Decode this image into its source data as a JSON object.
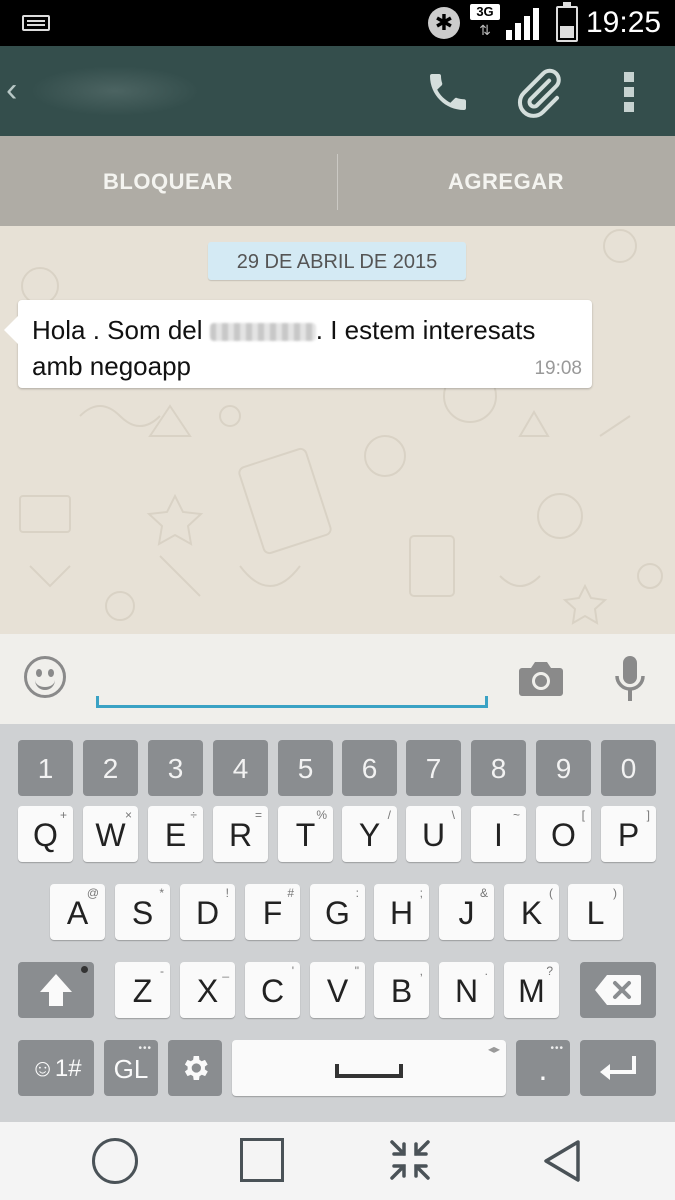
{
  "status_bar": {
    "network_type": "3G",
    "network_arrows": "⇅",
    "bluetooth_glyph": "✱",
    "time": "19:25"
  },
  "app_bar": {
    "back_glyph": "‹",
    "icons": [
      "back-icon",
      "phone-icon",
      "paperclip-icon",
      "overflow-menu-icon"
    ]
  },
  "actions": {
    "block_label": "BLOQUEAR",
    "add_label": "AGREGAR"
  },
  "chat": {
    "date_chip": "29 DE ABRIL DE 2015",
    "message": {
      "text_before": "Hola . Som del",
      "text_after": ". I estem interesats amb negoapp",
      "time": "19:08"
    },
    "background_color": "#e7e1d6"
  },
  "composer": {
    "value": "",
    "accent_color": "#3aa2c4",
    "icons": [
      "emoji-icon",
      "camera-icon",
      "microphone-icon"
    ]
  },
  "keyboard": {
    "number_row": [
      "1",
      "2",
      "3",
      "4",
      "5",
      "6",
      "7",
      "8",
      "9",
      "0"
    ],
    "row1": [
      {
        "k": "Q",
        "s": "+"
      },
      {
        "k": "W",
        "s": "×"
      },
      {
        "k": "E",
        "s": "÷"
      },
      {
        "k": "R",
        "s": "="
      },
      {
        "k": "T",
        "s": "%"
      },
      {
        "k": "Y",
        "s": "/"
      },
      {
        "k": "U",
        "s": "\\"
      },
      {
        "k": "I",
        "s": "~"
      },
      {
        "k": "O",
        "s": "["
      },
      {
        "k": "P",
        "s": "]"
      }
    ],
    "row2": [
      {
        "k": "A",
        "s": "@"
      },
      {
        "k": "S",
        "s": "*"
      },
      {
        "k": "D",
        "s": "!"
      },
      {
        "k": "F",
        "s": "#"
      },
      {
        "k": "G",
        "s": ":"
      },
      {
        "k": "H",
        "s": ";"
      },
      {
        "k": "J",
        "s": "&"
      },
      {
        "k": "K",
        "s": "("
      },
      {
        "k": "L",
        "s": ")"
      }
    ],
    "row3": [
      {
        "k": "Z",
        "s": "-"
      },
      {
        "k": "X",
        "s": "_"
      },
      {
        "k": "C",
        "s": "'"
      },
      {
        "k": "V",
        "s": "\""
      },
      {
        "k": "B",
        "s": ","
      },
      {
        "k": "N",
        "s": "."
      },
      {
        "k": "M",
        "s": "?"
      }
    ],
    "symbols_label": "☺1#",
    "language_label": "GL",
    "period_label": ".",
    "ellipsis": "•••",
    "space_arrows": "◂▸"
  },
  "colors": {
    "app_bar": "#344e4c",
    "date_chip": "#d4eaf4"
  }
}
